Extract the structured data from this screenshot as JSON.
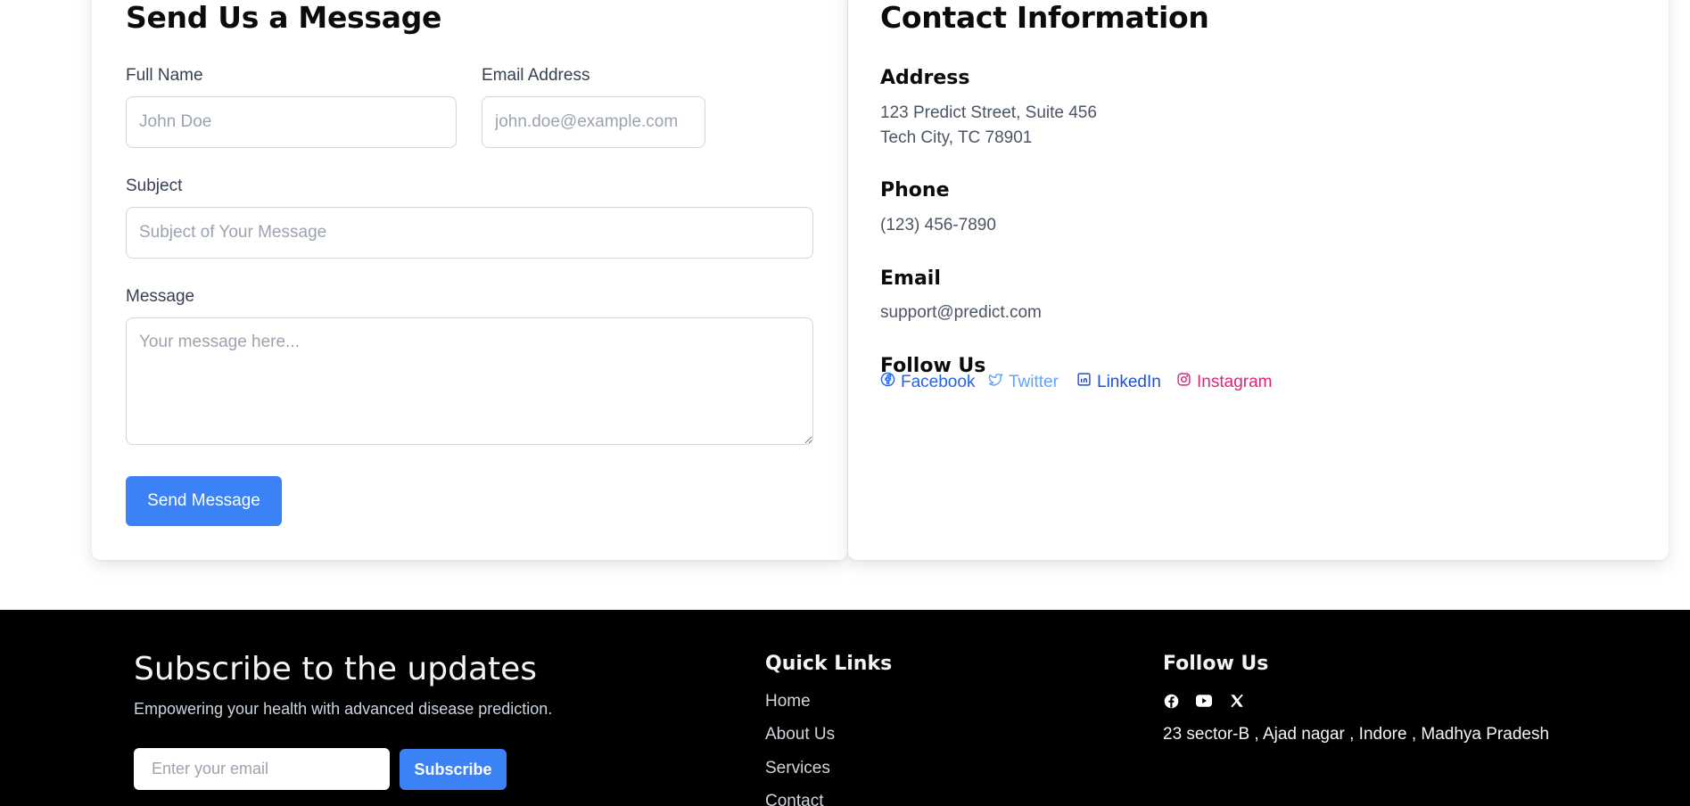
{
  "form": {
    "title": "Send Us a Message",
    "full_name_label": "Full Name",
    "full_name_placeholder": "John Doe",
    "email_label": "Email Address",
    "email_placeholder": "john.doe@example.com",
    "subject_label": "Subject",
    "subject_placeholder": "Subject of Your Message",
    "message_label": "Message",
    "message_placeholder": "Your message here...",
    "submit_label": "Send Message"
  },
  "contact": {
    "title": "Contact Information",
    "address_heading": "Address",
    "address_line1": "123 Predict Street, Suite 456",
    "address_line2": "Tech City, TC 78901",
    "phone_heading": "Phone",
    "phone": "(123) 456-7890",
    "email_heading": "Email",
    "email": "support@predict.com",
    "follow_heading": "Follow Us",
    "socials": [
      {
        "label": "Facebook",
        "icon": "facebook-icon",
        "color": "#2563eb"
      },
      {
        "label": "Twitter",
        "icon": "twitter-icon",
        "color": "#60a5fa"
      },
      {
        "label": "LinkedIn",
        "icon": "linkedin-icon",
        "color": "#1d4ed8"
      },
      {
        "label": "Instagram",
        "icon": "instagram-icon",
        "color": "#db2777"
      }
    ]
  },
  "footer": {
    "subscribe_title": "Subscribe to the updates",
    "subscribe_subtitle": "Empowering your health with advanced disease prediction.",
    "email_placeholder": "Enter your email",
    "subscribe_button": "Subscribe",
    "quick_links_heading": "Quick Links",
    "quick_links": [
      "Home",
      "About Us",
      "Services",
      "Contact"
    ],
    "follow_heading": "Follow Us",
    "follow_icons": [
      "facebook-icon",
      "youtube-icon",
      "x-icon"
    ],
    "address": "23 sector-B , Ajad nagar , Indore , Madhya Pradesh"
  },
  "colors": {
    "accent": "#3b82f6",
    "footer_bg": "#000000"
  }
}
